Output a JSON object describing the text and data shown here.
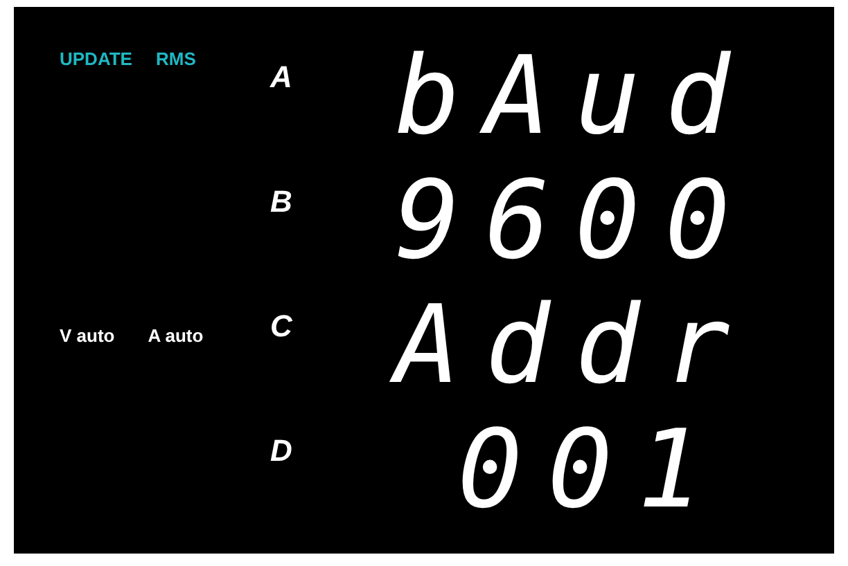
{
  "indicators_top": [
    "UPDATE",
    "RMS"
  ],
  "indicators_bottom": [
    "V auto",
    "A auto"
  ],
  "rows": [
    {
      "label": "A",
      "reading": "bAud"
    },
    {
      "label": "B",
      "reading": "9600"
    },
    {
      "label": "C",
      "reading": "Addr"
    },
    {
      "label": "D",
      "reading": "001"
    }
  ]
}
